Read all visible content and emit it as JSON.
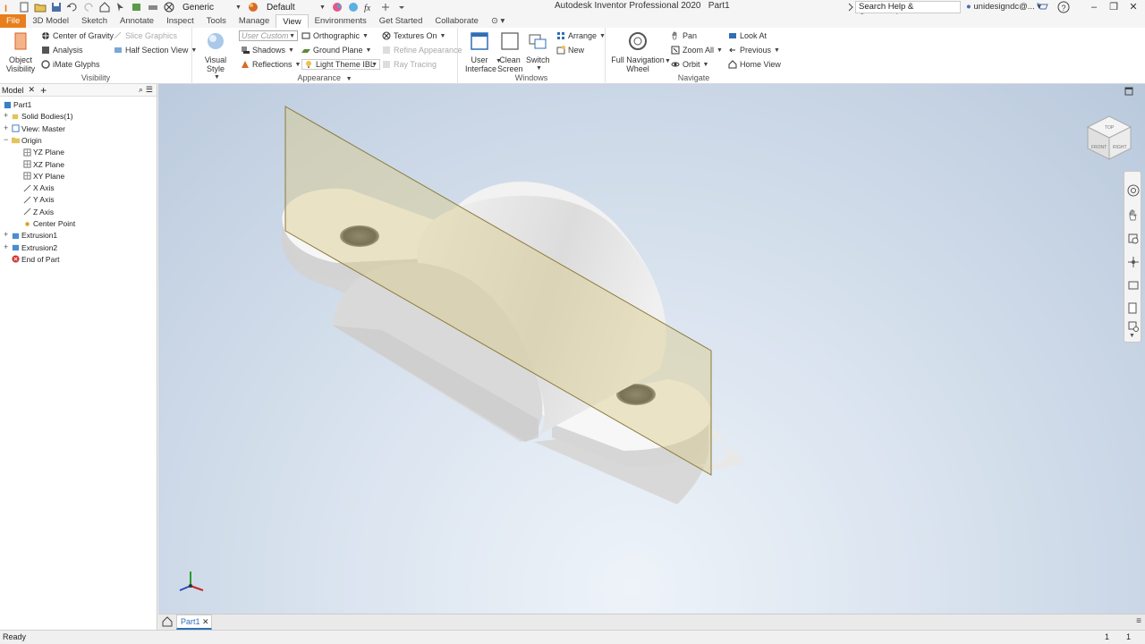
{
  "title": {
    "app": "Autodesk Inventor Professional 2020",
    "document": "Part1"
  },
  "qat": {
    "appearance_select": "Generic",
    "material_select": "Default"
  },
  "search": {
    "placeholder": "Search Help & Commands..."
  },
  "user": {
    "name": "unidesigndc@..."
  },
  "tabs": [
    "File",
    "3D Model",
    "Sketch",
    "Annotate",
    "Inspect",
    "Tools",
    "Manage",
    "View",
    "Environments",
    "Get Started",
    "Collaborate"
  ],
  "active_tab": "View",
  "ribbon": {
    "visibility": {
      "title": "Visibility",
      "object_visibility": "Object\nVisibility",
      "object_visibility_l1": "Object",
      "object_visibility_l2": "Visibility",
      "center_of_gravity": "Center of Gravity",
      "analysis": "Analysis",
      "imate_glyphs": "iMate Glyphs",
      "slice_graphics": "Slice Graphics",
      "half_section_view": "Half Section View"
    },
    "appearance": {
      "title": "Appearance",
      "visual_style": "Visual Style",
      "user_custom": "User Custom",
      "shadows": "Shadows",
      "reflections": "Reflections",
      "orthographic": "Orthographic",
      "ground_plane": "Ground Plane",
      "light_theme": "Light Theme IBL",
      "textures_on": "Textures On",
      "refine_appearance": "Refine Appearance",
      "ray_tracing": "Ray Tracing"
    },
    "windows": {
      "title": "Windows",
      "ui_l1": "User",
      "ui_l2": "Interface",
      "clean_l1": "Clean",
      "clean_l2": "Screen",
      "switch": "Switch",
      "arrange": "Arrange",
      "new": "New"
    },
    "navigate": {
      "title": "Navigate",
      "full_nav_l1": "Full Navigation",
      "full_nav_l2": "Wheel",
      "pan": "Pan",
      "zoom_all": "Zoom All",
      "orbit": "Orbit",
      "look_at": "Look At",
      "previous": "Previous",
      "home_view": "Home View"
    }
  },
  "browser": {
    "tab": "Model",
    "tree": [
      {
        "label": "Part1",
        "indent": 0,
        "icon": "part-icon",
        "expander": ""
      },
      {
        "label": "Solid Bodies(1)",
        "indent": 1,
        "icon": "solid-bodies-icon",
        "expander": "+"
      },
      {
        "label": "View: Master",
        "indent": 1,
        "icon": "view-icon",
        "expander": "+"
      },
      {
        "label": "Origin",
        "indent": 1,
        "icon": "folder-icon",
        "expander": "−"
      },
      {
        "label": "YZ Plane",
        "indent": 2,
        "icon": "plane-icon",
        "expander": ""
      },
      {
        "label": "XZ Plane",
        "indent": 2,
        "icon": "plane-icon",
        "expander": ""
      },
      {
        "label": "XY Plane",
        "indent": 2,
        "icon": "plane-icon",
        "expander": ""
      },
      {
        "label": "X Axis",
        "indent": 2,
        "icon": "axis-icon",
        "expander": ""
      },
      {
        "label": "Y Axis",
        "indent": 2,
        "icon": "axis-icon",
        "expander": ""
      },
      {
        "label": "Z Axis",
        "indent": 2,
        "icon": "axis-icon",
        "expander": ""
      },
      {
        "label": "Center Point",
        "indent": 2,
        "icon": "point-icon",
        "expander": ""
      },
      {
        "label": "Extrusion1",
        "indent": 1,
        "icon": "extrusion-icon",
        "expander": "+"
      },
      {
        "label": "Extrusion2",
        "indent": 1,
        "icon": "extrusion-icon",
        "expander": "+"
      },
      {
        "label": "End of Part",
        "indent": 1,
        "icon": "end-of-part-icon",
        "expander": ""
      }
    ]
  },
  "viewcube": {
    "top": "TOP",
    "front": "FRONT",
    "right": "RIGHT"
  },
  "doc_tab": "Part1",
  "status": {
    "text": "Ready",
    "count1": "1",
    "count2": "1"
  },
  "colors": {
    "file_tab": "#e87e1c",
    "plane": "#d9c98a",
    "part": "#ececec"
  }
}
